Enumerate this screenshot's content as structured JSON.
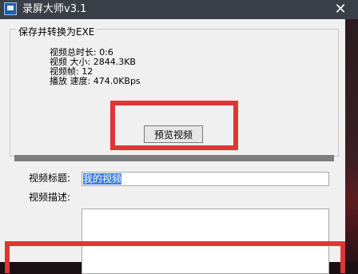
{
  "window": {
    "title": "录屏大师v3.1",
    "close_symbol": "✕"
  },
  "group": {
    "title": "保存并转换为EXE",
    "info": [
      "视频总时长: 0:6",
      "视频 大小: 2844.3KB",
      "视频帧: 12",
      "播放 速度: 474.0KBps"
    ]
  },
  "preview_button": {
    "label": "预览视频"
  },
  "form": {
    "title_label": "视频标题:",
    "title_value": "我的视频",
    "description_label": "视频描述:",
    "description_value": ""
  },
  "colors": {
    "highlight_box": "#e03535",
    "selection": "#3a7bd5",
    "titlebar": "#3b3f47"
  }
}
